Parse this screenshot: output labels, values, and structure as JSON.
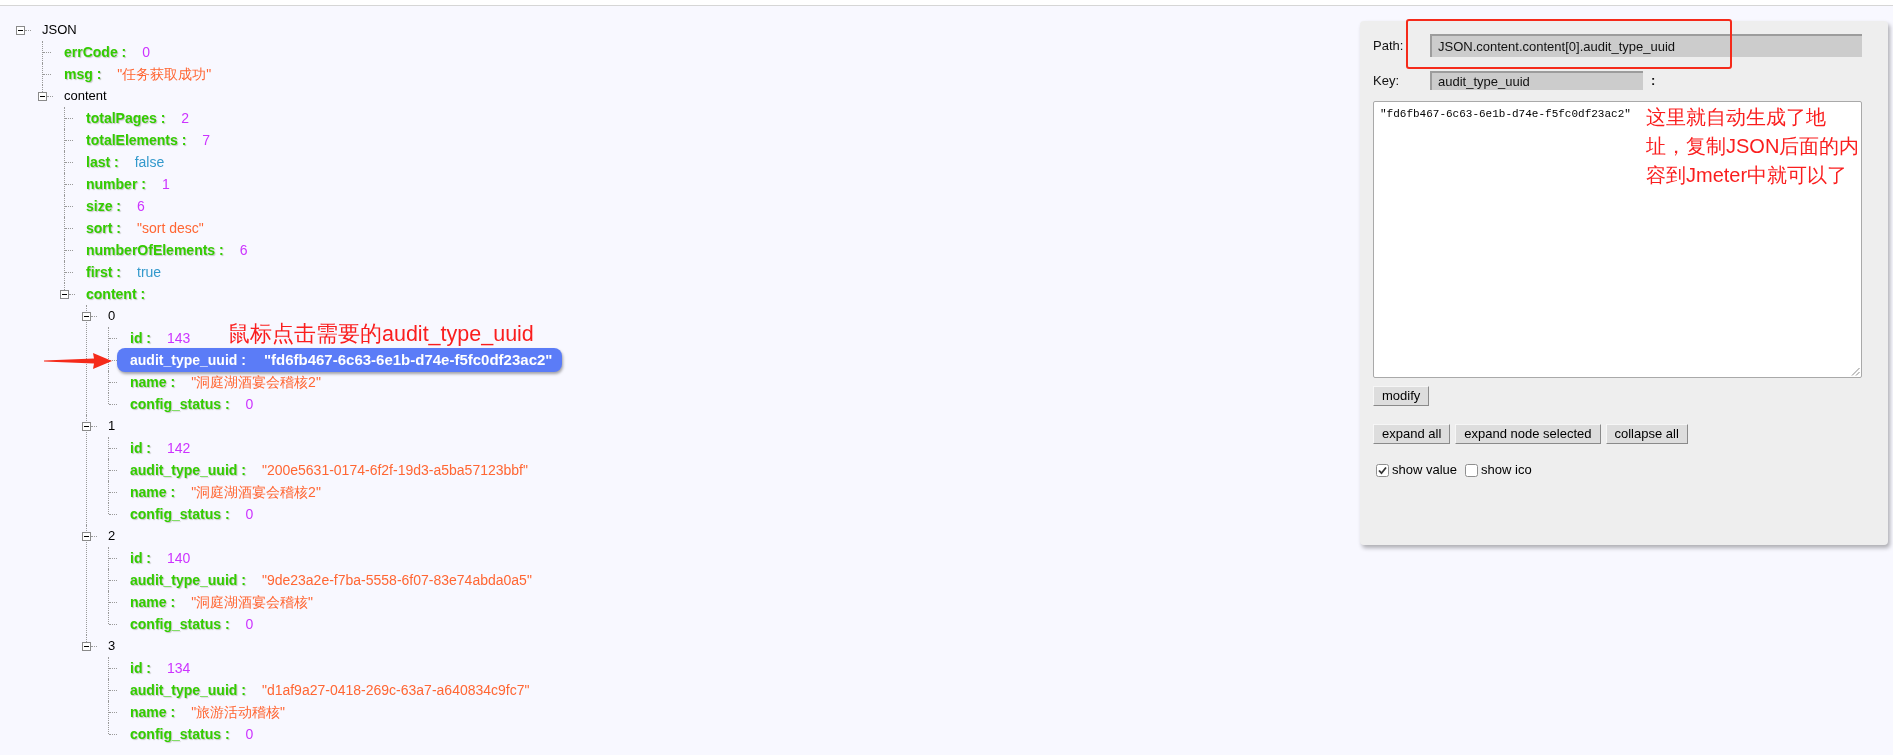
{
  "tree": {
    "label": "JSON",
    "expanded": true,
    "selected": false,
    "children": [
      {
        "key": "errCode :",
        "value": "0",
        "kind": "number",
        "selected": false
      },
      {
        "key": "msg :",
        "value": "\"任务获取成功\"",
        "kind": "string",
        "selected": false
      },
      {
        "label": "content",
        "expanded": true,
        "selected": false,
        "children": [
          {
            "key": "totalPages :",
            "value": "2",
            "kind": "number",
            "selected": false
          },
          {
            "key": "totalElements :",
            "value": "7",
            "kind": "number",
            "selected": false
          },
          {
            "key": "last :",
            "value": "false",
            "kind": "boolean",
            "selected": false
          },
          {
            "key": "number :",
            "value": "1",
            "kind": "number",
            "selected": false
          },
          {
            "key": "size :",
            "value": "6",
            "kind": "number",
            "selected": false
          },
          {
            "key": "sort :",
            "value": "\"sort desc\"",
            "kind": "string",
            "selected": false
          },
          {
            "key": "numberOfElements :",
            "value": "6",
            "kind": "number",
            "selected": false
          },
          {
            "key": "first :",
            "value": "true",
            "kind": "boolean",
            "selected": false
          },
          {
            "key": "content :",
            "expanded": true,
            "selected": false,
            "children": [
              {
                "label": "0",
                "expanded": true,
                "selected": false,
                "children": [
                  {
                    "key": "id :",
                    "value": "143",
                    "kind": "number",
                    "selected": false
                  },
                  {
                    "key": "audit_type_uuid :",
                    "value": "\"fd6fb467-6c63-6e1b-d74e-f5fc0df23ac2\"",
                    "selected": true
                  },
                  {
                    "key": "name :",
                    "value": "\"洞庭湖酒宴会稽核2\"",
                    "kind": "string",
                    "selected": false
                  },
                  {
                    "key": "config_status :",
                    "value": "0",
                    "kind": "number",
                    "selected": false
                  }
                ]
              },
              {
                "label": "1",
                "expanded": true,
                "selected": false,
                "children": [
                  {
                    "key": "id :",
                    "value": "142",
                    "kind": "number",
                    "selected": false
                  },
                  {
                    "key": "audit_type_uuid :",
                    "value": "\"200e5631-0174-6f2f-19d3-a5ba57123bbf\"",
                    "kind": "string",
                    "selected": false
                  },
                  {
                    "key": "name :",
                    "value": "\"洞庭湖酒宴会稽核2\"",
                    "kind": "string",
                    "selected": false
                  },
                  {
                    "key": "config_status :",
                    "value": "0",
                    "kind": "number",
                    "selected": false
                  }
                ]
              },
              {
                "label": "2",
                "expanded": true,
                "selected": false,
                "children": [
                  {
                    "key": "id :",
                    "value": "140",
                    "kind": "number",
                    "selected": false
                  },
                  {
                    "key": "audit_type_uuid :",
                    "value": "\"9de23a2e-f7ba-5558-6f07-83e74abda0a5\"",
                    "kind": "string",
                    "selected": false
                  },
                  {
                    "key": "name :",
                    "value": "\"洞庭湖酒宴会稽核\"",
                    "kind": "string",
                    "selected": false
                  },
                  {
                    "key": "config_status :",
                    "value": "0",
                    "kind": "number",
                    "selected": false
                  }
                ]
              },
              {
                "label": "3",
                "expanded": true,
                "selected": false,
                "children": [
                  {
                    "key": "id :",
                    "value": "134",
                    "kind": "number",
                    "selected": false
                  },
                  {
                    "key": "audit_type_uuid :",
                    "value": "\"d1af9a27-0418-269c-63a7-a640834c9fc7\"",
                    "kind": "string",
                    "selected": false
                  },
                  {
                    "key": "name :",
                    "value": "\"旅游活动稽核\"",
                    "kind": "string",
                    "selected": false
                  },
                  {
                    "key": "config_status :",
                    "value": "0",
                    "kind": "number",
                    "selected": false
                  }
                ]
              }
            ]
          }
        ]
      }
    ]
  },
  "panel": {
    "path_label": "Path:",
    "path": "JSON.content.content[0].audit_type_uuid",
    "key_label": "Key:",
    "key": "audit_type_uuid",
    "key_colon": ":",
    "value": "\"fd6fb467-6c63-6e1b-d74e-f5fc0df23ac2\"",
    "modify_button": "modify",
    "buttons": [
      "expand all",
      "expand node selected",
      "collapse all"
    ],
    "options": [
      {
        "label": "show value",
        "checked": true
      },
      {
        "label": "show ico",
        "checked": false
      }
    ]
  },
  "annotations": {
    "tree_note": "鼠标点击需要的audit_type_uuid",
    "panel_note": [
      "这里就自动生成了地",
      "址，复制JSON后面的内",
      "容到Jmeter中就可以了"
    ]
  }
}
